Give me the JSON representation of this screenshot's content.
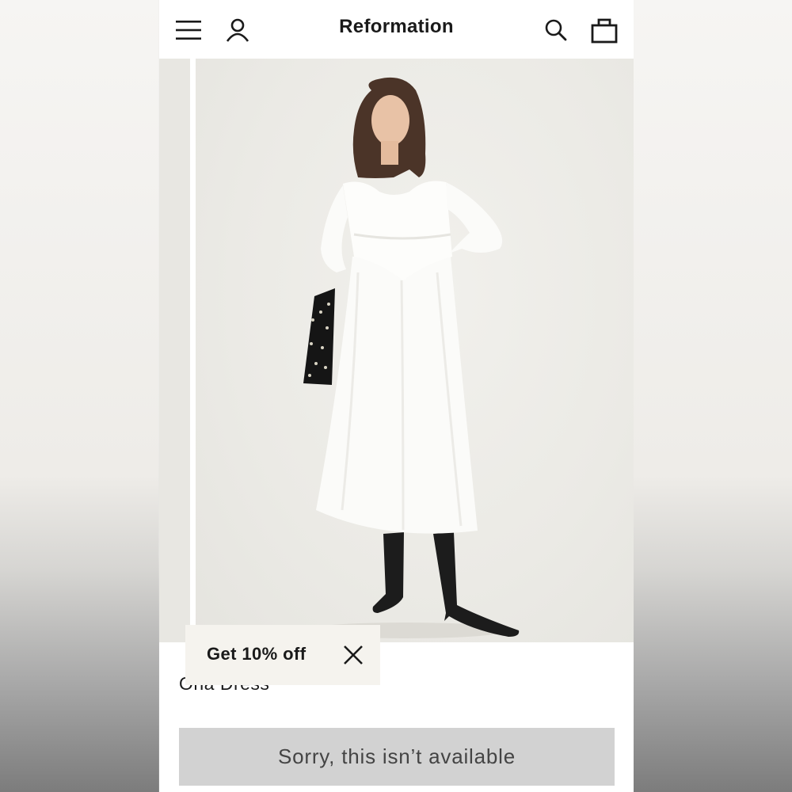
{
  "header": {
    "brand": "Reformation",
    "icons": [
      "menu-icon",
      "account-icon",
      "search-icon",
      "bag-icon"
    ]
  },
  "promo": {
    "label": "Get 10% off",
    "close_icon": "close-icon"
  },
  "product": {
    "name": "Ona Dress"
  },
  "availability": {
    "button_label": "Sorry, this isn’t available"
  },
  "colors": {
    "text": "#1a1a1a",
    "promo_bg": "#f5f3ee",
    "unavailable_bg": "#d2d2d2",
    "image_bg": "#ecebe6"
  }
}
